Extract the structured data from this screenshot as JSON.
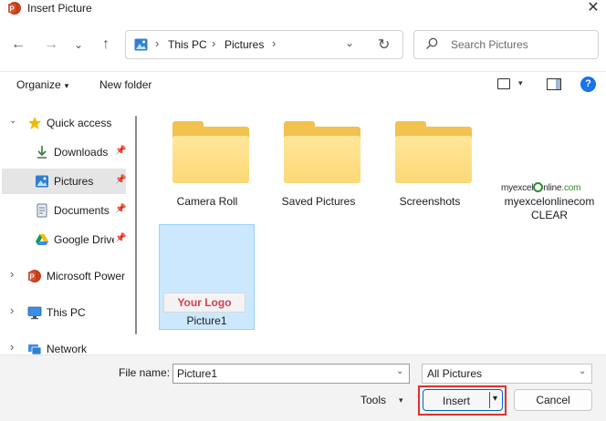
{
  "window": {
    "title": "Insert Picture",
    "close_glyph": "✕"
  },
  "nav": {
    "back": "←",
    "forward": "→",
    "recent": "⌄",
    "up": "↑"
  },
  "address": {
    "segments": [
      "This PC",
      "Pictures"
    ],
    "separator": "›",
    "dropdown": "⌄",
    "refresh": "↻"
  },
  "search": {
    "placeholder": "Search Pictures"
  },
  "commands": {
    "organize": "Organize",
    "new_folder": "New folder",
    "caret": "▾",
    "help": "?"
  },
  "sidebar": {
    "items": [
      {
        "label": "Quick access",
        "icon": "star-icon",
        "expanded": true
      },
      {
        "label": "Downloads",
        "icon": "download-icon",
        "pinned": true
      },
      {
        "label": "Pictures",
        "icon": "pictures-icon",
        "pinned": true,
        "selected": true
      },
      {
        "label": "Documents",
        "icon": "documents-icon",
        "pinned": true
      },
      {
        "label": "Google Drive",
        "icon": "google-drive-icon",
        "pinned": true
      },
      {
        "label": "Microsoft Power",
        "icon": "powerpoint-icon",
        "expanded": false
      },
      {
        "label": "This PC",
        "icon": "monitor-icon",
        "expanded": false
      },
      {
        "label": "Network",
        "icon": "network-icon",
        "expanded": false
      }
    ],
    "pin_glyph": "📌",
    "expand_glyph": "›",
    "collapse_glyph": "⌄"
  },
  "files": [
    {
      "name": "Camera Roll",
      "kind": "folder"
    },
    {
      "name": "Saved Pictures",
      "kind": "folder"
    },
    {
      "name": "Screenshots",
      "kind": "folder"
    },
    {
      "name": "myexcelonlinecomCLEAR",
      "kind": "image",
      "thumb_text_a": "myexcel",
      "thumb_text_b": "nline",
      "thumb_text_c": ".com"
    },
    {
      "name": "Picture1",
      "kind": "image",
      "selected": true,
      "thumb_text": "Your Logo"
    }
  ],
  "footer": {
    "file_name_label": "File name:",
    "file_name_value": "Picture1",
    "file_type": "All Pictures",
    "tools": "Tools",
    "insert": "Insert",
    "cancel": "Cancel",
    "caret": "⌄"
  },
  "colors": {
    "accent": "#0067c0",
    "highlight_ring": "#e03030",
    "selection_fill": "#cce8ff",
    "folder": "#f2c14e",
    "logo_text": "#d73b54",
    "help": "#1a73e8"
  }
}
